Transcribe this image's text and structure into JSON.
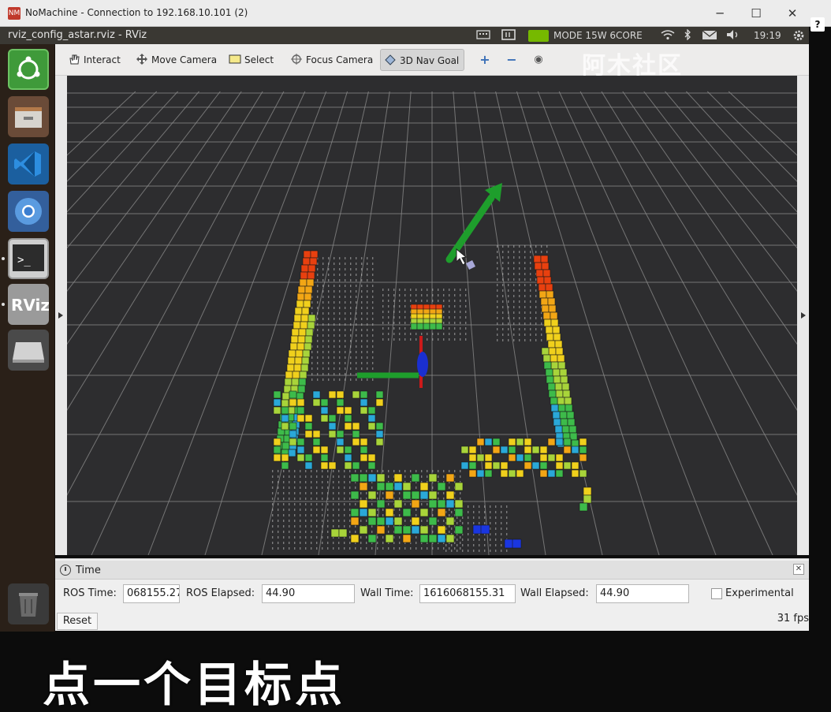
{
  "nomachine": {
    "title": "NoMachine - Connection to 192.168.10.101 (2)",
    "logo_text": "NM",
    "minimize": "─",
    "maximize": "☐",
    "close": "✕",
    "help": "?"
  },
  "panel": {
    "window_title": "rviz_config_astar.rviz - RViz",
    "power_mode": "MODE 15W 6CORE",
    "clock": "19:19"
  },
  "launcher": {
    "items": [
      "ubuntu-dash",
      "files",
      "vscode",
      "chromium",
      "terminal",
      "rviz",
      "disk",
      "trash"
    ],
    "terminal_glyph": ">_",
    "rviz_text": "RViz"
  },
  "toolbar": {
    "interact": "Interact",
    "move_camera": "Move Camera",
    "select": "Select",
    "focus_camera": "Focus Camera",
    "nav_goal": "3D Nav Goal",
    "add": "+",
    "remove": "−",
    "eye": "◉"
  },
  "watermark": "阿木社区",
  "time_panel": {
    "title": "Time",
    "ros_time_label": "ROS Time:",
    "ros_time_value": "068155.27",
    "ros_elapsed_label": "ROS Elapsed:",
    "ros_elapsed_value": "44.90",
    "wall_time_label": "Wall Time:",
    "wall_time_value": "1616068155.31",
    "wall_elapsed_label": "Wall Elapsed:",
    "wall_elapsed_value": "44.90",
    "experimental_label": "Experimental",
    "reset_label": "Reset",
    "fps": "31 fps"
  },
  "subtitle": "点一个目标点",
  "colors": {
    "render_bg": "#2d2d2f",
    "grid": "#8d8d8d",
    "goal_arrow": "#1e9e2c",
    "axis_red": "#cc1a1a",
    "axis_blue": "#1a2fd0",
    "voxel_palette": [
      "#e8400f",
      "#f2a615",
      "#f0d01c",
      "#a8d43a",
      "#3dbb4a",
      "#2aa8d8",
      "#1a36e0"
    ]
  }
}
